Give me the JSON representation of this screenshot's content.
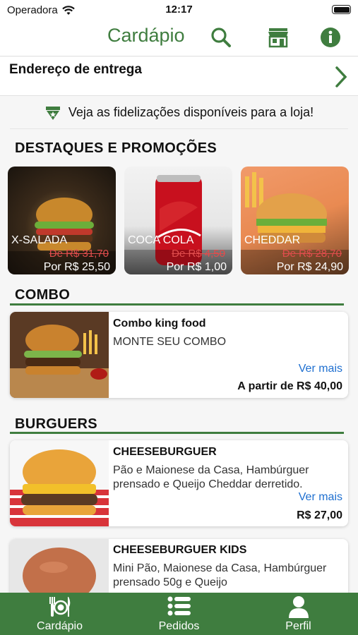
{
  "status_bar": {
    "carrier": "Operadora",
    "time": "12:17"
  },
  "header": {
    "title": "Cardápio",
    "icons": [
      "search-icon",
      "store-icon",
      "info-icon"
    ]
  },
  "address": {
    "label": "Endereço de entrega"
  },
  "loyalty": {
    "text": "Veja as fidelizações disponíveis para a loja!"
  },
  "promotions": {
    "title": "DESTAQUES E PROMOÇÕES",
    "items": [
      {
        "name": "X-SALADA",
        "old_price": "De R$ 31,70",
        "price": "Por R$ 25,50"
      },
      {
        "name": "COCA COLA",
        "old_price": "De R$ 4,50",
        "price": "Por R$ 1,00"
      },
      {
        "name": "CHEDDAR",
        "old_price": "De R$ 28,70",
        "price": "Por R$ 24,90"
      }
    ]
  },
  "combo": {
    "title": "COMBO",
    "items": [
      {
        "name": "Combo king food",
        "description": "MONTE SEU COMBO",
        "more": "Ver mais",
        "price": "A partir de R$ 40,00"
      }
    ]
  },
  "burgers": {
    "title": "BURGUERS",
    "items": [
      {
        "name": "CHEESEBURGUER",
        "description": "Pão e Maionese da Casa, Hambúrguer prensado e Queijo Cheddar derretido.",
        "more": "Ver mais",
        "price": "R$ 27,00"
      },
      {
        "name": "CHEESEBURGUER KIDS",
        "description": "Mini Pão, Maionese da Casa, Hambúrguer prensado 50g e Queijo"
      }
    ]
  },
  "tabbar": {
    "tabs": [
      {
        "label": "Cardápio",
        "icon": "plate-cutlery-icon"
      },
      {
        "label": "Pedidos",
        "icon": "list-icon"
      },
      {
        "label": "Perfil",
        "icon": "user-icon"
      }
    ]
  },
  "colors": {
    "brand_green": "#3f7d3f",
    "link_blue": "#1e6fd0",
    "strike_red": "#e04d4d"
  }
}
